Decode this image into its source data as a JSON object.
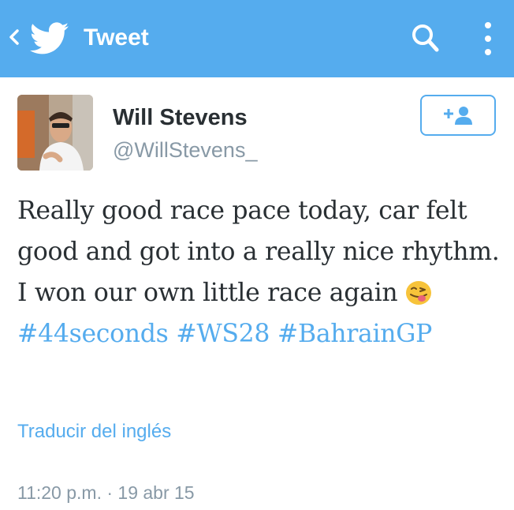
{
  "header": {
    "back_icon": "chevron-left-icon",
    "logo_icon": "twitter-bird-icon",
    "title": "Tweet",
    "search_icon": "search-icon",
    "menu_icon": "more-vertical-icon",
    "background_color": "#55acee"
  },
  "author": {
    "name": "Will Stevens",
    "handle": "@WillStevens_",
    "avatar_icon": "avatar",
    "follow_icon": "follow-user-icon"
  },
  "tweet": {
    "text_parts": [
      "Really good race pace today, car felt good and got into a really nice rhythm. I won our own little race again "
    ],
    "emoji": "face-with-tongue-emoji",
    "hashtags": [
      "#44seconds",
      "#WS28",
      "#BahrainGP"
    ]
  },
  "translate": {
    "label": "Traducir del inglés"
  },
  "meta": {
    "timestamp": "11:20 p.m. · 19 abr 15"
  },
  "colors": {
    "accent": "#55acee",
    "text": "#292f33",
    "secondary": "#8899a6"
  }
}
